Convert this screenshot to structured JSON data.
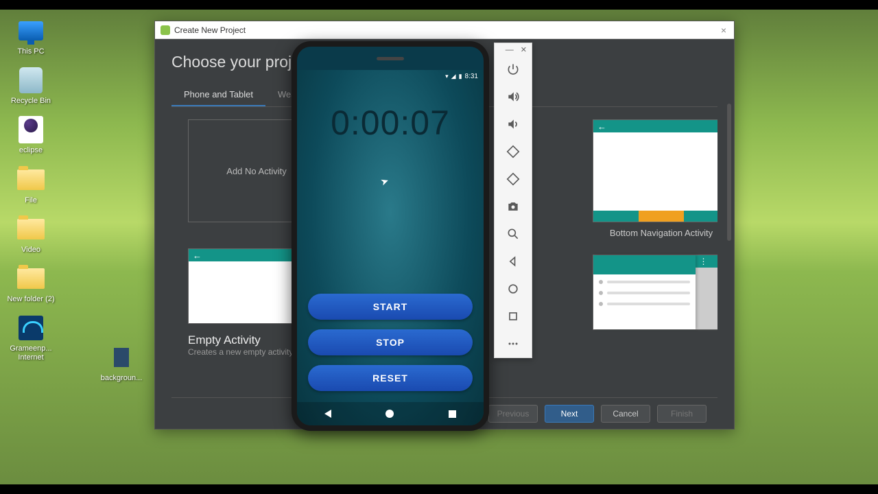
{
  "desktop": {
    "icons": [
      {
        "label": "This PC"
      },
      {
        "label": "Recycle Bin"
      },
      {
        "label": "eclipse"
      },
      {
        "label": "File"
      },
      {
        "label": "Video"
      },
      {
        "label": "New folder (2)"
      },
      {
        "label": "Grameenp... Internet"
      }
    ],
    "icon2_label": "backgroun..."
  },
  "dialog": {
    "title": "Create New Project",
    "heading": "Choose your project",
    "tabs": [
      {
        "label": "Phone and Tablet",
        "active": true
      },
      {
        "label": "Wear OS",
        "active": false
      }
    ],
    "templates": {
      "no_activity_label": "Add No Activity",
      "bottom_nav_label": "Bottom Navigation Activity",
      "empty_activity_name": "Empty Activity",
      "empty_activity_desc": "Creates a new empty activity"
    },
    "buttons": {
      "previous": "Previous",
      "next": "Next",
      "cancel": "Cancel",
      "finish": "Finish"
    }
  },
  "emulator": {
    "status_time": "8:31",
    "timer_value": "0:00:07",
    "buttons": {
      "start": "START",
      "stop": "STOP",
      "reset": "RESET"
    }
  }
}
